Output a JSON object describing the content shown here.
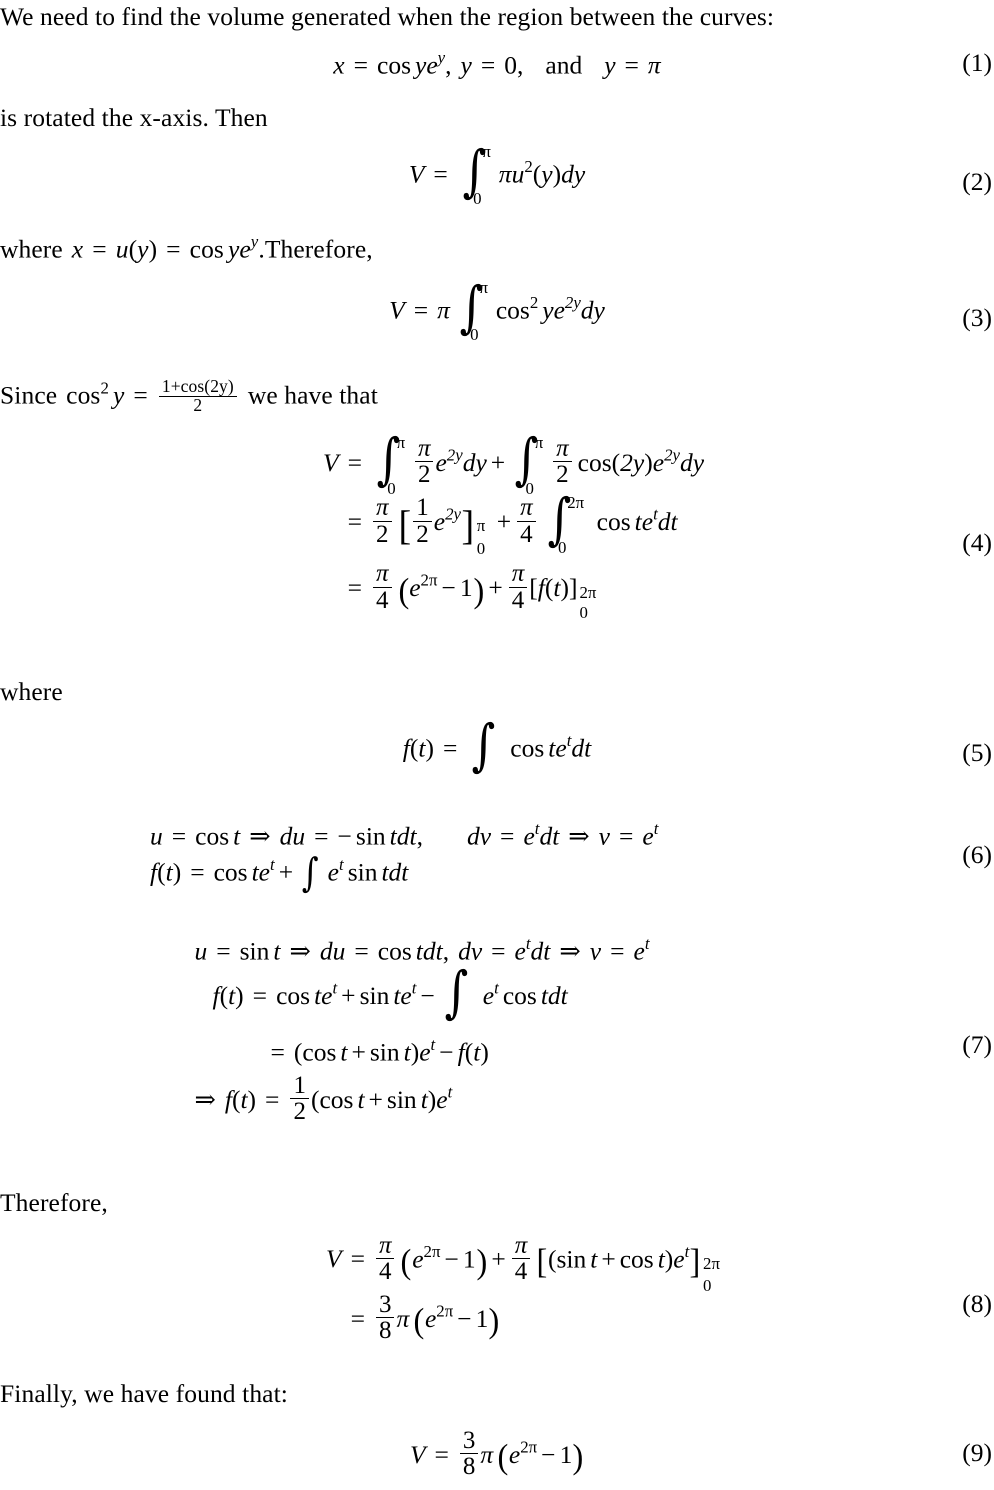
{
  "document": {
    "type": "latex-math-solution",
    "title_text": "We need to find the volume generated when the region between the curves:",
    "body_font_color": "#000000",
    "background": "#ffffff"
  },
  "prose": {
    "intro": "We need to find the volume generated when the region between the curves:",
    "after_eq1": "is rotated the x-axis.  Then",
    "after_eq2_where": "where",
    "after_eq2_where_tail": ".Therefore,",
    "since_lead": "Since",
    "since_tail": "we have that",
    "where_plain": "where",
    "therefore": "Therefore,",
    "finally": "Finally, we have found that:"
  },
  "symbols": {
    "V": "V",
    "x": "x",
    "y": "y",
    "u": "u",
    "t": "t",
    "f": "f",
    "v": "v",
    "e": "e",
    "pi": "π",
    "equals": "=",
    "plus": "+",
    "minus": "−",
    "implies": "⇒",
    "comma": ",",
    "integral": "∫",
    "cos": "cos",
    "sin": "sin",
    "d": "d",
    "lparen": "(",
    "rparen": ")",
    "lbrack": "[",
    "rbrack": "]",
    "zero": "0",
    "one": "1",
    "two": "2",
    "three": "3",
    "four": "4",
    "eight": "8",
    "twopi": "2π",
    "2y": "2y"
  },
  "equations": [
    {
      "id": "eq1",
      "number": "(1)",
      "latex": "x = \\cos y e^{y},\\; y = 0,\\;\\text{and}\\; y = \\pi",
      "plain": "x = cos y e^y,  y = 0,  and  y = π",
      "and_word": "and"
    },
    {
      "id": "eq2",
      "number": "(2)",
      "latex": "V = \\int_{0}^{\\pi} \\pi u^{2}(y) dy",
      "plain": "V = ∫_0^π π u²(y) dy",
      "lower_limit": "0",
      "upper_limit": "π"
    },
    {
      "id": "eq3",
      "number": "(3)",
      "latex": "V = \\pi \\int_{0}^{\\pi} \\cos^{2} y e^{2y} dy",
      "plain": "V = π ∫_0^π cos² y e^{2y} dy",
      "lower_limit": "0",
      "upper_limit": "π"
    },
    {
      "id": "eq4",
      "number": "(4)",
      "latex": "V = \\int_0^\\pi \\frac{\\pi}{2} e^{2y} dy + \\int_0^\\pi \\frac{\\pi}{2}\\cos(2y) e^{2y} dy = \\frac{\\pi}{2}\\left[\\frac{1}{2}e^{2y}\\right]_0^\\pi + \\frac{\\pi}{4}\\int_0^{2\\pi}\\cos t e^t dt = \\frac{\\pi}{4}\\left(e^{2\\pi}-1\\right)+\\frac{\\pi}{4}[f(t)]_0^{2\\pi}",
      "lines": [
        "V = ∫_0^π (π/2) e^{2y} dy + ∫_0^π (π/2) cos(2y) e^{2y} dy",
        "= (π/2) [ (1/2) e^{2y} ]_0^π + (π/4) ∫_0^{2π} cos t e^t dt",
        "= (π/4) ( e^{2π} − 1 ) + (π/4) [ f(t) ]_0^{2π}"
      ]
    },
    {
      "id": "eq5",
      "number": "(5)",
      "latex": "f(t) = \\int \\cos t e^{t} dt",
      "plain": "f(t) = ∫ cos t e^t dt"
    },
    {
      "id": "eq6",
      "number": "(6)",
      "latex": "u = \\cos t \\Rightarrow du = -\\sin t dt, \\quad dv = e^t dt \\Rightarrow v = e^t \\\\ f(t) = \\cos t e^t + \\int e^t \\sin t dt",
      "lines": [
        "u = cos t ⇒ du = − sin t dt,    dv = e^t dt ⇒ v = e^t",
        "f(t) = cos t e^t + ∫ e^t sin t dt"
      ]
    },
    {
      "id": "eq7",
      "number": "(7)",
      "latex": "u = \\sin t \\Rightarrow du = \\cos t dt,\\; dv = e^t dt \\Rightarrow v = e^t \\\\ f(t) = \\cos t e^t + \\sin t e^t - \\int e^t \\cos t dt = (\\cos t + \\sin t) e^t - f(t) \\Rightarrow f(t) = \\tfrac{1}{2}(\\cos t + \\sin t) e^t",
      "lines": [
        "u = sin t ⇒ du = cos t dt,  dv = e^t dt ⇒ v = e^t",
        "f(t) = cos t e^t + sin t e^t − ∫ e^t cos t dt",
        "= (cos t + sin t) e^t − f(t)",
        "⇒ f(t) = (1/2)(cos t + sin t) e^t"
      ]
    },
    {
      "id": "eq8",
      "number": "(8)",
      "latex": "V = \\frac{\\pi}{4}\\left(e^{2\\pi}-1\\right)+\\frac{\\pi}{4}\\left[(\\sin t + \\cos t)e^t\\right]_0^{2\\pi} = \\frac{3}{8}\\pi\\left(e^{2\\pi}-1\\right)",
      "lines": [
        "V = (π/4) ( e^{2π} − 1 ) + (π/4) [ (sin t + cos t) e^t ]_0^{2π}",
        "= (3/8) π ( e^{2π} − 1 )"
      ]
    },
    {
      "id": "eq9",
      "number": "(9)",
      "latex": "V = \\frac{3}{8}\\pi\\left(e^{2\\pi}-1\\right)",
      "plain": "V = (3/8) π ( e^{2π} − 1 )"
    }
  ],
  "fraction_inline": {
    "since_numerator": "1+cos(2y)",
    "since_denominator": "2"
  }
}
